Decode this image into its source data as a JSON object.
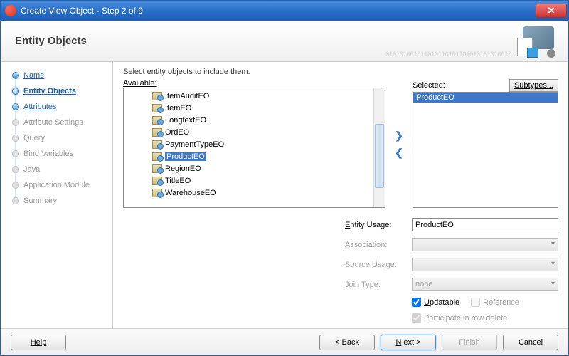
{
  "window": {
    "title": "Create View Object - Step 2 of 9"
  },
  "header": {
    "title": "Entity Objects",
    "bg_bits": "010101001011010110101101010101010010"
  },
  "nav": {
    "steps": [
      {
        "label": "Name",
        "state": "done link"
      },
      {
        "label": "Entity Objects",
        "state": "current"
      },
      {
        "label": "Attributes",
        "state": "link"
      },
      {
        "label": "Attribute Settings",
        "state": "pending"
      },
      {
        "label": "Query",
        "state": "pending"
      },
      {
        "label": "Bind Variables",
        "state": "pending"
      },
      {
        "label": "Java",
        "state": "pending"
      },
      {
        "label": "Application Module",
        "state": "pending"
      },
      {
        "label": "Summary",
        "state": "pending"
      }
    ]
  },
  "main": {
    "instruction": "Select entity objects to include them.",
    "available_label": "Available:",
    "selected_label": "Selected:",
    "subtypes_label": "Subtypes...",
    "available": [
      "ItemAuditEO",
      "ItemEO",
      "LongtextEO",
      "OrdEO",
      "PaymentTypeEO",
      "ProductEO",
      "RegionEO",
      "TitleEO",
      "WarehouseEO"
    ],
    "available_selected_index": 5,
    "selected": [
      "ProductEO"
    ],
    "form": {
      "entity_usage_label": "Entity Usage:",
      "entity_usage_value": "ProductEO",
      "association_label": "Association:",
      "source_usage_label": "Source Usage:",
      "join_type_label": "Join Type:",
      "join_type_value": "none",
      "updatable_label": "Updatable",
      "reference_label": "Reference",
      "participate_label": "Participate in row delete"
    }
  },
  "footer": {
    "help": "Help",
    "back": "< Back",
    "next": "Next >",
    "finish": "Finish",
    "cancel": "Cancel"
  }
}
